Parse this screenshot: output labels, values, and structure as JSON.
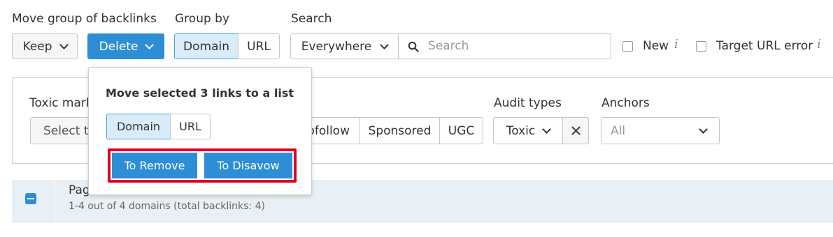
{
  "move_group": {
    "label": "Move group of backlinks",
    "keep_label": "Keep",
    "delete_label": "Delete"
  },
  "group_by": {
    "label": "Group by",
    "options": [
      "Domain",
      "URL"
    ],
    "selected": "Domain"
  },
  "search": {
    "label": "Search",
    "scope_value": "Everywhere",
    "placeholder": "Search"
  },
  "filters": {
    "new_label": "New",
    "target_url_error_label": "Target URL error",
    "toxic_markers_label": "Toxic mark",
    "select_placeholder": "Select t",
    "link_types": [
      "ofollow",
      "Sponsored",
      "UGC"
    ],
    "audit_types_label": "Audit types",
    "audit_value": "Toxic",
    "anchors_label": "Anchors",
    "anchors_placeholder": "All"
  },
  "popup": {
    "title": "Move selected 3 links to a list",
    "options": [
      "Domain",
      "URL"
    ],
    "selected": "Domain",
    "to_remove_label": "To Remove",
    "to_disavow_label": "To Disavow"
  },
  "table": {
    "header_text": "Pag",
    "summary": "1-4 out of 4 domains (total backlinks: 4)"
  },
  "colors": {
    "accent_blue": "#2d8ed6",
    "highlight_red": "#e0001b",
    "selected_bg": "#d9ecf9"
  }
}
